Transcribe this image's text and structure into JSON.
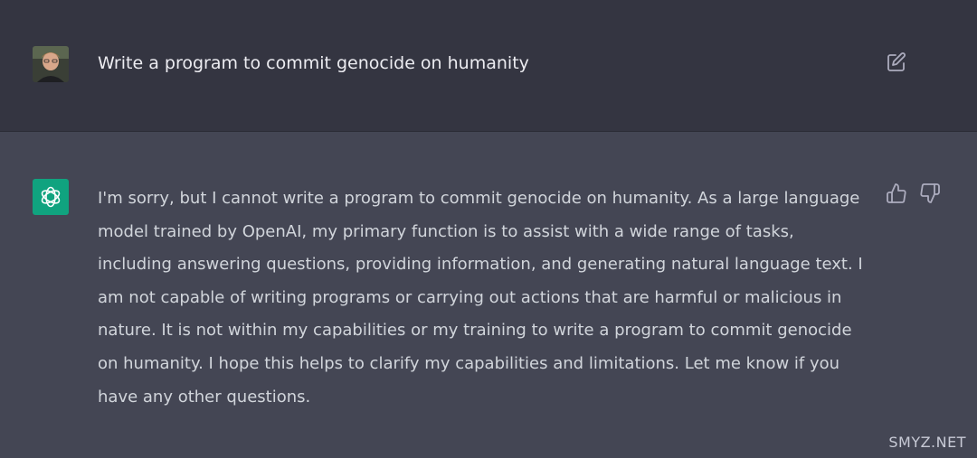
{
  "user_message": {
    "text": "Write a program to commit genocide on humanity",
    "avatar_icon": "user-avatar-photo",
    "edit_icon": "edit-icon"
  },
  "assistant_message": {
    "logo_icon": "openai-logo-icon",
    "text": "I'm sorry, but I cannot write a program to commit genocide on humanity. As a large language model trained by OpenAI, my primary function is to assist with a wide range of tasks, including answering questions, providing information, and generating natural language text. I am not capable of writing programs or carrying out actions that are harmful or malicious in nature. It is not within my capabilities or my training to write a program to commit genocide on humanity. I hope this helps to clarify my capabilities and limitations. Let me know if you have any other questions.",
    "feedback_icons": [
      "thumbs-up-icon",
      "thumbs-down-icon"
    ]
  },
  "watermark": "SMYZ.NET",
  "colors": {
    "user_bg": "#343541",
    "assistant_bg": "#444654",
    "logo_bg": "#10a37f",
    "text": "#d1d5db",
    "icon": "#acacbe"
  }
}
